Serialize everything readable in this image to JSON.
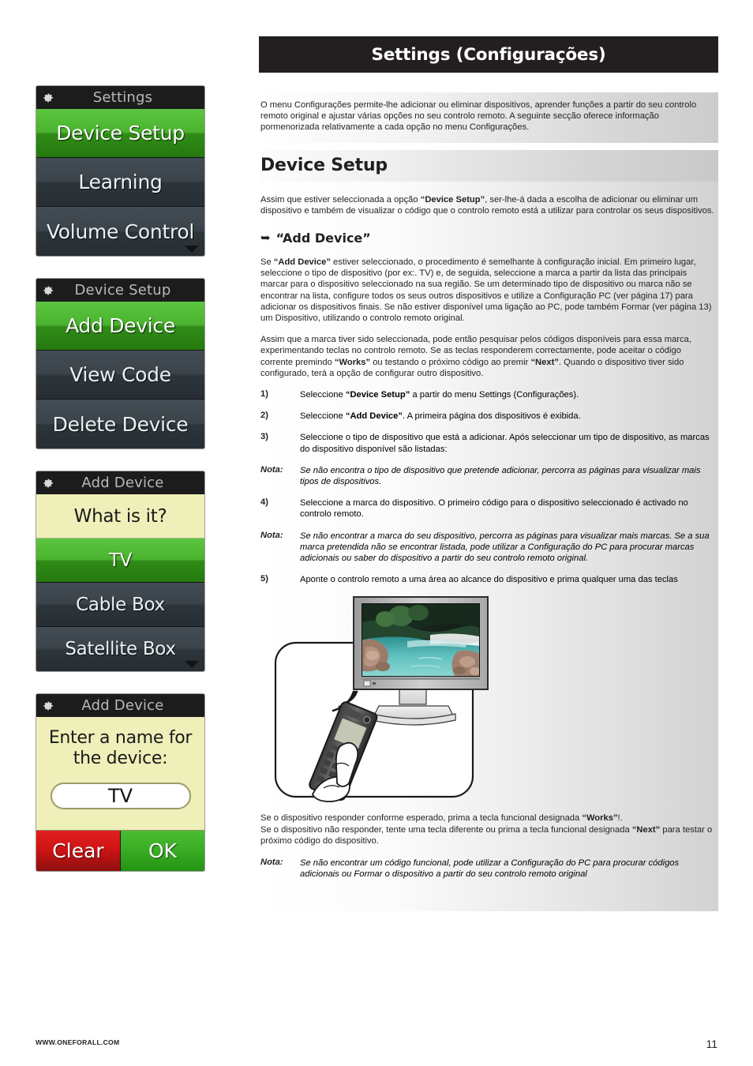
{
  "header": {
    "title": "Settings (Configurações)"
  },
  "intro": {
    "text": "O menu Configurações permite-lhe adicionar ou eliminar dispositivos, aprender funções a partir do seu controlo remoto original e ajustar várias opções no seu controlo remoto. A seguinte secção oferece informação pormenorizada relativamente a cada opção no menu Configurações."
  },
  "section": {
    "title": "Device Setup"
  },
  "paragraphs": {
    "p1_a": "Assim que estiver seleccionada a opção ",
    "p1_b": "“Device Setup”",
    "p1_c": ", ser-lhe-á dada a escolha de adicionar ou eliminar um dispositivo e também de visualizar o código que o controlo remoto está a utilizar para controlar os seus dispositivos.",
    "subhead_icon": "arrow-pointer-icon",
    "subhead": "“Add Device”",
    "p2_a": "Se ",
    "p2_b": "“Add Device”",
    "p2_c": " estiver seleccionado, o procedimento é semelhante à configuração inicial. Em primeiro lugar, seleccione o tipo de dispositivo (por ex:. TV) e, de seguida, seleccione a marca a partir da lista das principais marcar para o dispositivo seleccionado na sua região. Se um determinado tipo de dispositivo ou marca não se encontrar na lista, configure todos os seus outros dispositivos e utilize a Configuração PC (ver página 17) para adicionar os dispositivos finais. Se não estiver disponível uma ligação ao PC, pode também Formar (ver página 13) um Dispositivo, utilizando o controlo remoto original.",
    "p3_a": "Assim que a marca tiver sido seleccionada, pode então pesquisar pelos códigos disponíveis para essa marca, experimentando teclas no controlo remoto. Se as teclas responderem correctamente, pode aceitar o código corrente premindo ",
    "p3_b": "“Works”",
    "p3_c": " ou testando o próximo código ao premir ",
    "p3_d": "“Next”",
    "p3_e": ". Quando o dispositivo tiver sido configurado, terá a opção de configurar outro dispositivo."
  },
  "steps": [
    {
      "num": "1)",
      "pre": "Seleccione ",
      "bold": "“Device Setup”",
      "post": " a partir do menu Settings (Configurações).",
      "type": "step"
    },
    {
      "num": "2)",
      "pre": "Seleccione ",
      "bold": "“Add Device”",
      "post": ". A primeira página dos dispositivos é exibida.",
      "type": "step"
    },
    {
      "num": "3)",
      "pre": "Seleccione o tipo de dispositivo que está a adicionar. Após seleccionar um tipo de dispositivo, as marcas do dispositivo disponível são listadas:",
      "bold": "",
      "post": "",
      "type": "step"
    },
    {
      "num": "Nota:",
      "pre": "Se não encontra o tipo de dispositivo que pretende adicionar, percorra as páginas para visualizar mais tipos de dispositivos.",
      "bold": "",
      "post": "",
      "type": "note"
    },
    {
      "num": "4)",
      "pre": "Seleccione a marca do dispositivo. O primeiro código para o dispositivo seleccionado é activado no controlo remoto.",
      "bold": "",
      "post": "",
      "type": "step"
    },
    {
      "num": "Nota:",
      "pre": "Se não encontrar a marca do seu dispositivo, percorra as páginas para visualizar mais marcas.  Se a sua marca pretendida não se encontrar listada, pode utilizar a Configuração do PC para procurar marcas adicionais ou saber do dispositivo a partir do seu controlo remoto original.",
      "bold": "",
      "post": "",
      "type": "note"
    },
    {
      "num": "5)",
      "pre": "Aponte o controlo remoto a uma área ao alcance do dispositivo e prima qualquer uma das teclas",
      "bold": "",
      "post": "",
      "type": "step"
    }
  ],
  "closing": {
    "l1_a": "Se o dispositivo responder conforme esperado, prima a tecla funcional designada ",
    "l1_b": "“Works”",
    "l1_c": "!.",
    "l2_a": "Se o dispositivo não responder, tente uma tecla diferente ou prima a tecla funcional designada ",
    "l2_b": "“Next”",
    "l2_c": " para testar o próximo código do dispositivo.",
    "note_label": "Nota:",
    "note_text": "Se não encontrar um código funcional, pode utilizar a Configuração do PC para procurar códigos adicionais ou Formar o dispositivo a partir do seu controlo remoto original"
  },
  "illustration": {
    "name": "remote-pointing-at-tv-illustration",
    "tv": "flat-screen-tv-icon",
    "remote": "universal-remote-icon",
    "signal": "ir-signal-waves-icon",
    "hand": "hand-holding-remote-icon"
  },
  "screens": [
    {
      "id": "settings",
      "header_icon": "gear-icon",
      "header_title": "Settings",
      "rows": [
        {
          "label": "Device Setup",
          "style": "green"
        },
        {
          "label": "Learning",
          "style": "dark"
        },
        {
          "label": "Volume Control",
          "style": "dark",
          "chevron": true
        }
      ]
    },
    {
      "id": "device-setup",
      "header_icon": "gear-icon",
      "header_title": "Device Setup",
      "rows": [
        {
          "label": "Add Device",
          "style": "green"
        },
        {
          "label": "View Code",
          "style": "dark"
        },
        {
          "label": "Delete Device",
          "style": "dark"
        }
      ]
    },
    {
      "id": "add-device-type",
      "header_icon": "gear-icon",
      "header_title": "Add Device",
      "rows": [
        {
          "label": "What is it?",
          "style": "yellow"
        },
        {
          "label": "TV",
          "style": "green"
        },
        {
          "label": "Cable Box",
          "style": "dark"
        },
        {
          "label": "Satellite Box",
          "style": "dark",
          "chevron": true
        }
      ]
    },
    {
      "id": "add-device-name",
      "header_icon": "gear-icon",
      "header_title": "Add Device",
      "prompt": "Enter a name for\nthe device:",
      "input_value": "TV",
      "buttons": [
        {
          "label": "Clear",
          "style": "clear"
        },
        {
          "label": "OK",
          "style": "ok"
        }
      ]
    }
  ],
  "footer": {
    "url": "WWW.ONEFORALL.COM",
    "page": "11"
  },
  "colors": {
    "header_bar": "#231f20",
    "accent_green": "#3bae26",
    "lcd_dark": "#343c42",
    "lcd_yellow": "#efefb9",
    "clear_red": "#d01414"
  }
}
